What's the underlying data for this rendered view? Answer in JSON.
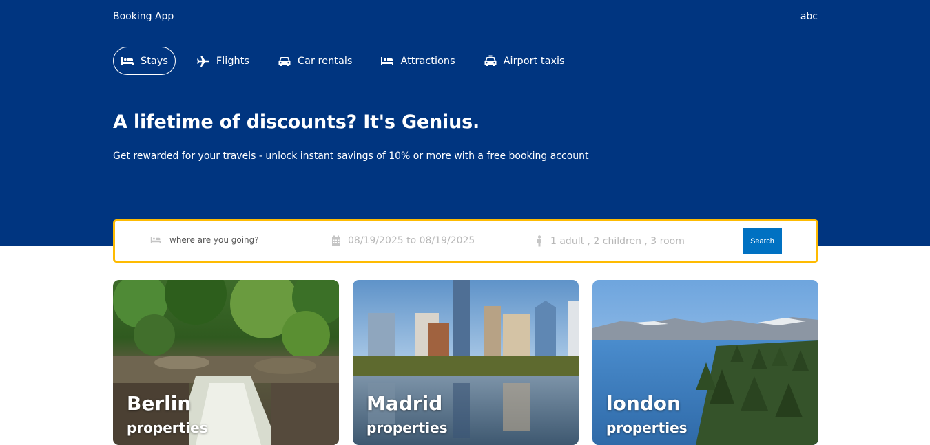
{
  "app": {
    "title": "Booking App",
    "user": "abc"
  },
  "nav": {
    "tabs": [
      {
        "label": "Stays",
        "icon": "bed-icon",
        "active": true
      },
      {
        "label": "Flights",
        "icon": "plane-icon",
        "active": false
      },
      {
        "label": "Car rentals",
        "icon": "car-icon",
        "active": false
      },
      {
        "label": "Attractions",
        "icon": "bed-icon",
        "active": false
      },
      {
        "label": "Airport taxis",
        "icon": "taxi-icon",
        "active": false
      }
    ]
  },
  "hero": {
    "title": "A lifetime of discounts? It's Genius.",
    "subtitle": "Get rewarded for your travels - unlock instant savings of 10% or more with a free booking account"
  },
  "search": {
    "destination_placeholder": "where are you going?",
    "dates": "08/19/2025 to 08/19/2025",
    "guests": "1 adult , 2 children , 3 room",
    "button": "Search"
  },
  "cities": [
    {
      "name": "Berlin",
      "sub": "properties"
    },
    {
      "name": "Madrid",
      "sub": "properties"
    },
    {
      "name": "london",
      "sub": "properties"
    }
  ],
  "colors": {
    "header": "#003580",
    "search_border": "#febb02",
    "button": "#0071c2"
  }
}
